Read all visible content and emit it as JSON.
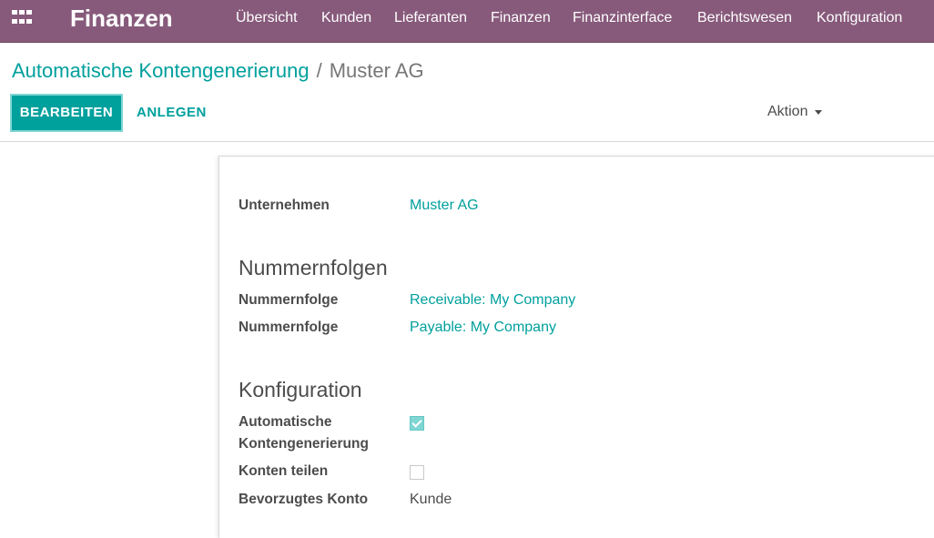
{
  "navbar": {
    "brand": "Finanzen",
    "apps_icon": "apps-grid-icon",
    "menu": [
      {
        "label": "Übersicht"
      },
      {
        "label": "Kunden"
      },
      {
        "label": "Lieferanten"
      },
      {
        "label": "Finanzen"
      },
      {
        "label": "Finanzinterface"
      },
      {
        "label": "Berichtswesen"
      },
      {
        "label": "Konfiguration"
      }
    ]
  },
  "breadcrumb": {
    "parent": "Automatische Kontengenerierung",
    "separator": "/",
    "current": "Muster AG"
  },
  "toolbar": {
    "edit_label": "BEARBEITEN",
    "create_label": "ANLEGEN",
    "action_label": "Aktion"
  },
  "form": {
    "company_label": "Unternehmen",
    "company_value": "Muster AG",
    "sequences_title": "Nummernfolgen",
    "sequences": [
      {
        "label": "Nummernfolge",
        "value": "Receivable: My Company"
      },
      {
        "label": "Nummernfolge",
        "value": "Payable: My Company"
      }
    ],
    "config_title": "Konfiguration",
    "auto_generation_label_line1": "Automatische",
    "auto_generation_label_line2": "Kontengenerierung",
    "auto_generation_checked": true,
    "share_accounts_label": "Konten teilen",
    "share_accounts_checked": false,
    "preferred_account_label": "Bevorzugtes Konto",
    "preferred_account_value": "Kunde"
  },
  "colors": {
    "navbar": "#875A7B",
    "accent": "#00A09D",
    "text": "#4c4c4c"
  }
}
